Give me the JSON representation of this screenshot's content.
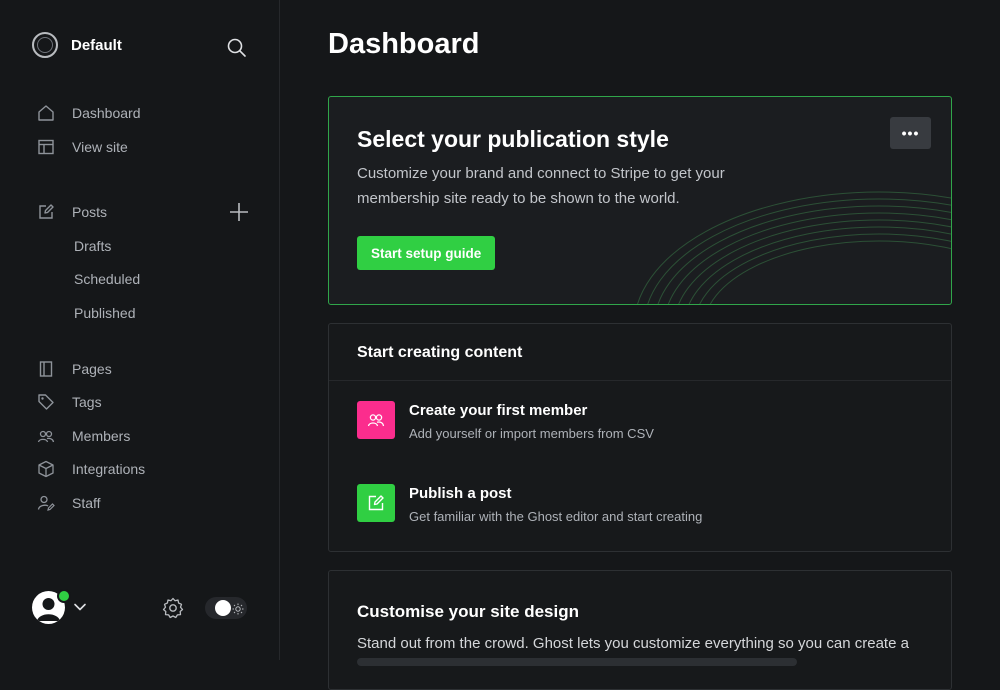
{
  "sidebar": {
    "site_name": "Default",
    "nav_primary": [
      {
        "label": "Dashboard",
        "icon": "home-icon"
      },
      {
        "label": "View site",
        "icon": "layout-icon"
      }
    ],
    "posts": {
      "label": "Posts",
      "icon": "pencil-icon",
      "sub_items": [
        "Drafts",
        "Scheduled",
        "Published"
      ]
    },
    "nav_secondary": [
      {
        "label": "Pages",
        "icon": "page-icon"
      },
      {
        "label": "Tags",
        "icon": "tag-icon"
      },
      {
        "label": "Members",
        "icon": "members-icon"
      },
      {
        "label": "Integrations",
        "icon": "box-icon"
      },
      {
        "label": "Staff",
        "icon": "staff-icon"
      }
    ]
  },
  "main": {
    "title": "Dashboard",
    "hero": {
      "title": "Select your publication style",
      "description": "Customize your brand and connect to Stripe to get your membership site ready to be shown to the world.",
      "button_label": "Start setup guide",
      "more_label": "•••"
    },
    "content_card": {
      "title": "Start creating content",
      "tasks": [
        {
          "title": "Create your first member",
          "subtitle": "Add yourself or import members from CSV",
          "icon": "members-icon",
          "color": "#fb2d8d"
        },
        {
          "title": "Publish a post",
          "subtitle": "Get familiar with the Ghost editor and start creating",
          "icon": "edit-icon",
          "color": "#30cf43"
        }
      ]
    },
    "design_card": {
      "title": "Customise your site design",
      "text": "Stand out from the crowd. Ghost lets you customize everything so you can create a"
    }
  },
  "colors": {
    "accent_green": "#30cf43",
    "accent_pink": "#fb2d8d",
    "background": "#151719"
  }
}
